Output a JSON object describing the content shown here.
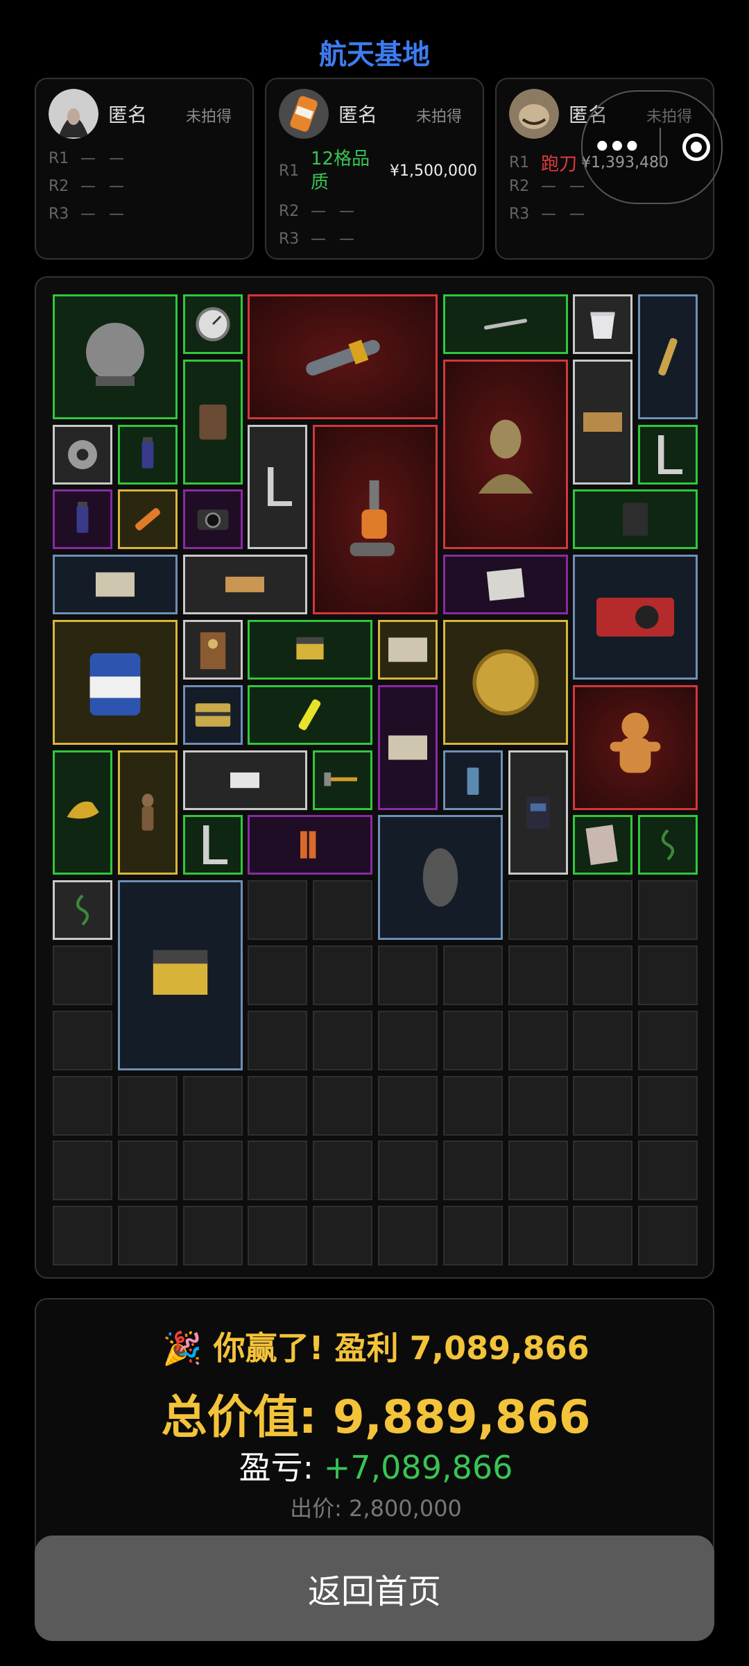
{
  "header": {
    "title": "航天基地"
  },
  "players": [
    {
      "name": "匿名",
      "status": "未拍得",
      "rows": [
        {
          "label": "R1",
          "text": "— —"
        },
        {
          "label": "R2",
          "text": "— —"
        },
        {
          "label": "R3",
          "text": "— —"
        }
      ]
    },
    {
      "name": "匿名",
      "status": "未拍得",
      "rows": [
        {
          "label": "R1",
          "bid": "12格品质",
          "amount": "¥1,500,000"
        },
        {
          "label": "R2",
          "text": "— —"
        },
        {
          "label": "R3",
          "text": "— —"
        }
      ]
    },
    {
      "name": "匿名",
      "status": "未拍得",
      "rows": [
        {
          "label": "R1",
          "bid": "跑刀",
          "amount": "¥1,393,480"
        },
        {
          "label": "R2",
          "text": "— —"
        },
        {
          "label": "R3",
          "text": "— —"
        }
      ]
    }
  ],
  "colors": {
    "title": "#3d7cf0",
    "gold": "#f3c33a",
    "profit": "#39c455",
    "bid_green": "#39c455",
    "bid_red": "#e23b3b"
  },
  "result": {
    "emoji": "🎉",
    "win_text": "你赢了! 盈利 7,089,866",
    "total_label": "总价值:",
    "total_value": "9,889,866",
    "pl_label": "盈亏:",
    "pl_value": "+7,089,866",
    "bid_label": "出价:",
    "bid_value": "2,800,000"
  },
  "actions": {
    "home": "返回首页"
  },
  "items": [
    "spice-rack",
    "pressure-gauge",
    "missile",
    "metal-rod",
    "yogurt-cup",
    "telescope",
    "leather-notebook",
    "bust-statue",
    "carpet-square",
    "tape-roll",
    "vial",
    "l-square",
    "vacuum-cleaner",
    "l-square",
    "vial",
    "flashlight",
    "camera",
    "diary",
    "old-map",
    "wood-panel",
    "map-drawing",
    "graphics-card",
    "paint-can",
    "clock-cabinet",
    "nail-box",
    "old-map",
    "gold-coin",
    "supply-crate",
    "glue-stick",
    "old-map",
    "gingerbread-man",
    "jackal-head",
    "statuette",
    "photo",
    "hammer",
    "battery",
    "pc-case",
    "l-square",
    "battery-pack",
    "stone",
    "magazine",
    "rope",
    "rope",
    "nail-box",
    "cement-bag"
  ]
}
